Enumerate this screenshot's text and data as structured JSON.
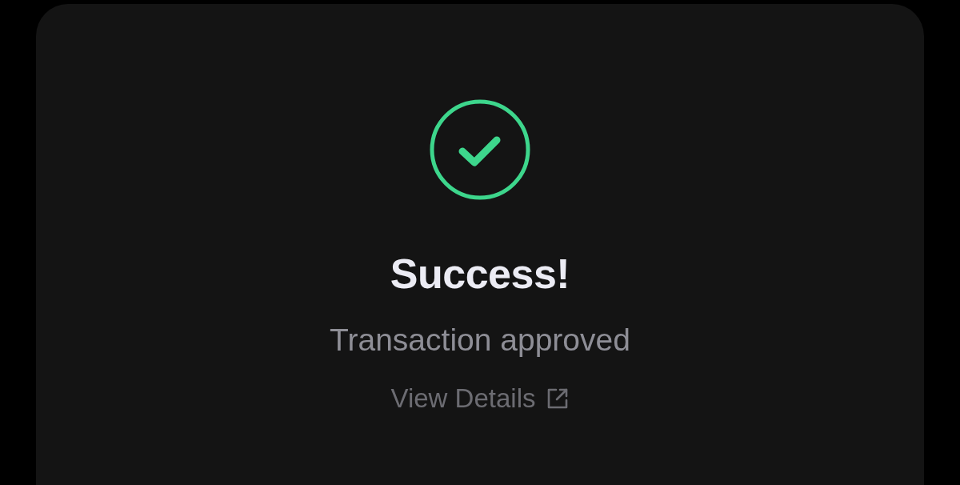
{
  "result": {
    "title": "Success!",
    "message": "Transaction approved",
    "link": {
      "label": "View Details"
    }
  }
}
